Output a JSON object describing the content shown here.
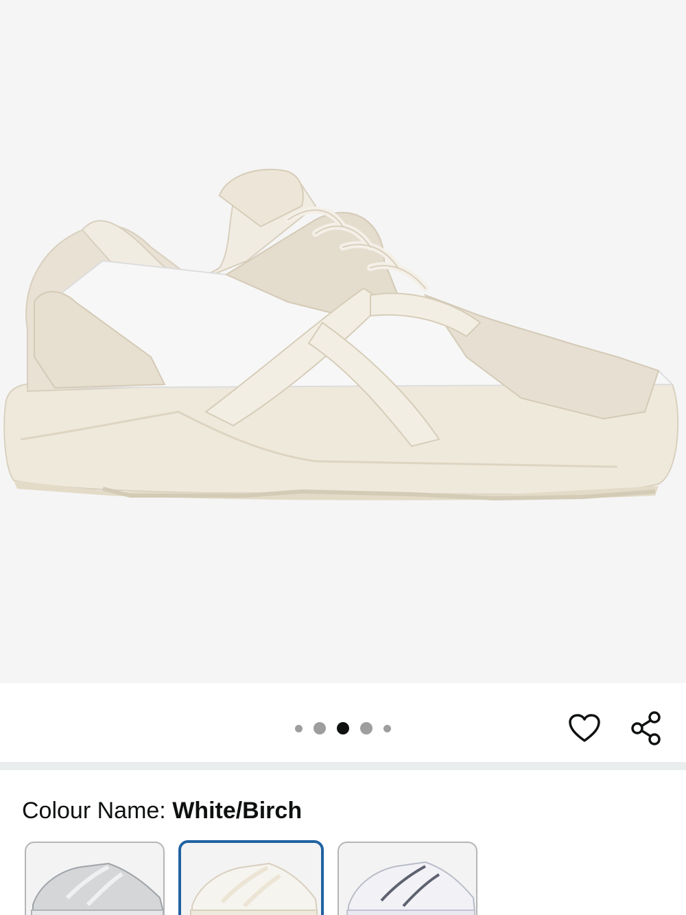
{
  "product": {
    "image_name": "white-birch-sneaker",
    "gallery": {
      "total_images": 5,
      "active_index": 2
    }
  },
  "actions": {
    "wishlist_icon": "heart-icon",
    "share_icon": "share-icon"
  },
  "colour": {
    "label": "Colour Name: ",
    "value": "White/Birch",
    "options": [
      {
        "icon": "silver-sneaker-thumbnail",
        "selected": false
      },
      {
        "icon": "white-birch-sneaker-thumbnail",
        "selected": true
      },
      {
        "icon": "white-lilac-sneaker-thumbnail",
        "selected": false
      }
    ]
  },
  "colors": {
    "page_background": "#f5f5f5",
    "selected_border": "#2162a1",
    "active_dot": "#0f1111",
    "inactive_dot": "#9e9e9e"
  }
}
